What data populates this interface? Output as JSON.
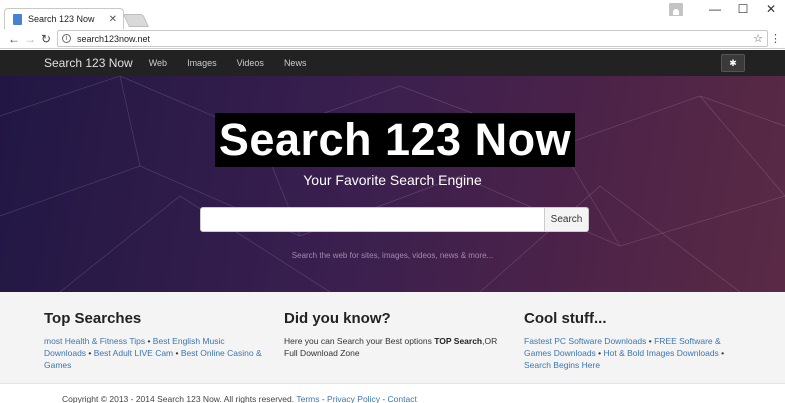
{
  "browser": {
    "tab_title": "Search 123 Now",
    "tab_close": "✕",
    "url": "search123now.net",
    "window_minimize": "—",
    "window_maximize": "☐",
    "window_close": "✕"
  },
  "navbar": {
    "brand": "Search 123 Now",
    "links": [
      "Web",
      "Images",
      "Videos",
      "News"
    ]
  },
  "hero": {
    "title": "Search 123 Now",
    "subtitle": "Your Favorite Search Engine",
    "search_value": "",
    "search_button": "Search",
    "hint": "Search the web for sites, images, videos, news & more..."
  },
  "top_searches": {
    "heading": "Top Searches",
    "items": [
      "most Health & Fitness Tips",
      "Best English Music Downloads",
      "Best Adult LIVE Cam",
      "Best Online Casino & Games"
    ]
  },
  "did_you_know": {
    "heading": "Did you know?",
    "text_before": "Here you can Search your Best options ",
    "bold": "TOP Search",
    "text_after": ",OR Full Download Zone"
  },
  "cool_stuff": {
    "heading": "Cool stuff...",
    "items": [
      "Fastest PC Software Downloads",
      "FREE Software & Games Downloads",
      "Hot & Bold Images Downloads",
      "Search Begins Here"
    ]
  },
  "footer": {
    "copyright": "Copyright © 2013 - 2014 Search 123 Now. All rights reserved.",
    "links": [
      "Terms",
      "Privacy Policy",
      "Contact"
    ]
  },
  "icons": {
    "back": "←",
    "forward": "→",
    "reload": "↻",
    "info": "i",
    "star": "☆",
    "menu": "⋮",
    "gear": "✱"
  },
  "colors": {
    "navbar_bg": "#222222",
    "hero_bg_start": "#211744",
    "hero_bg_end": "#5a2a45",
    "link": "#3b76b5"
  }
}
